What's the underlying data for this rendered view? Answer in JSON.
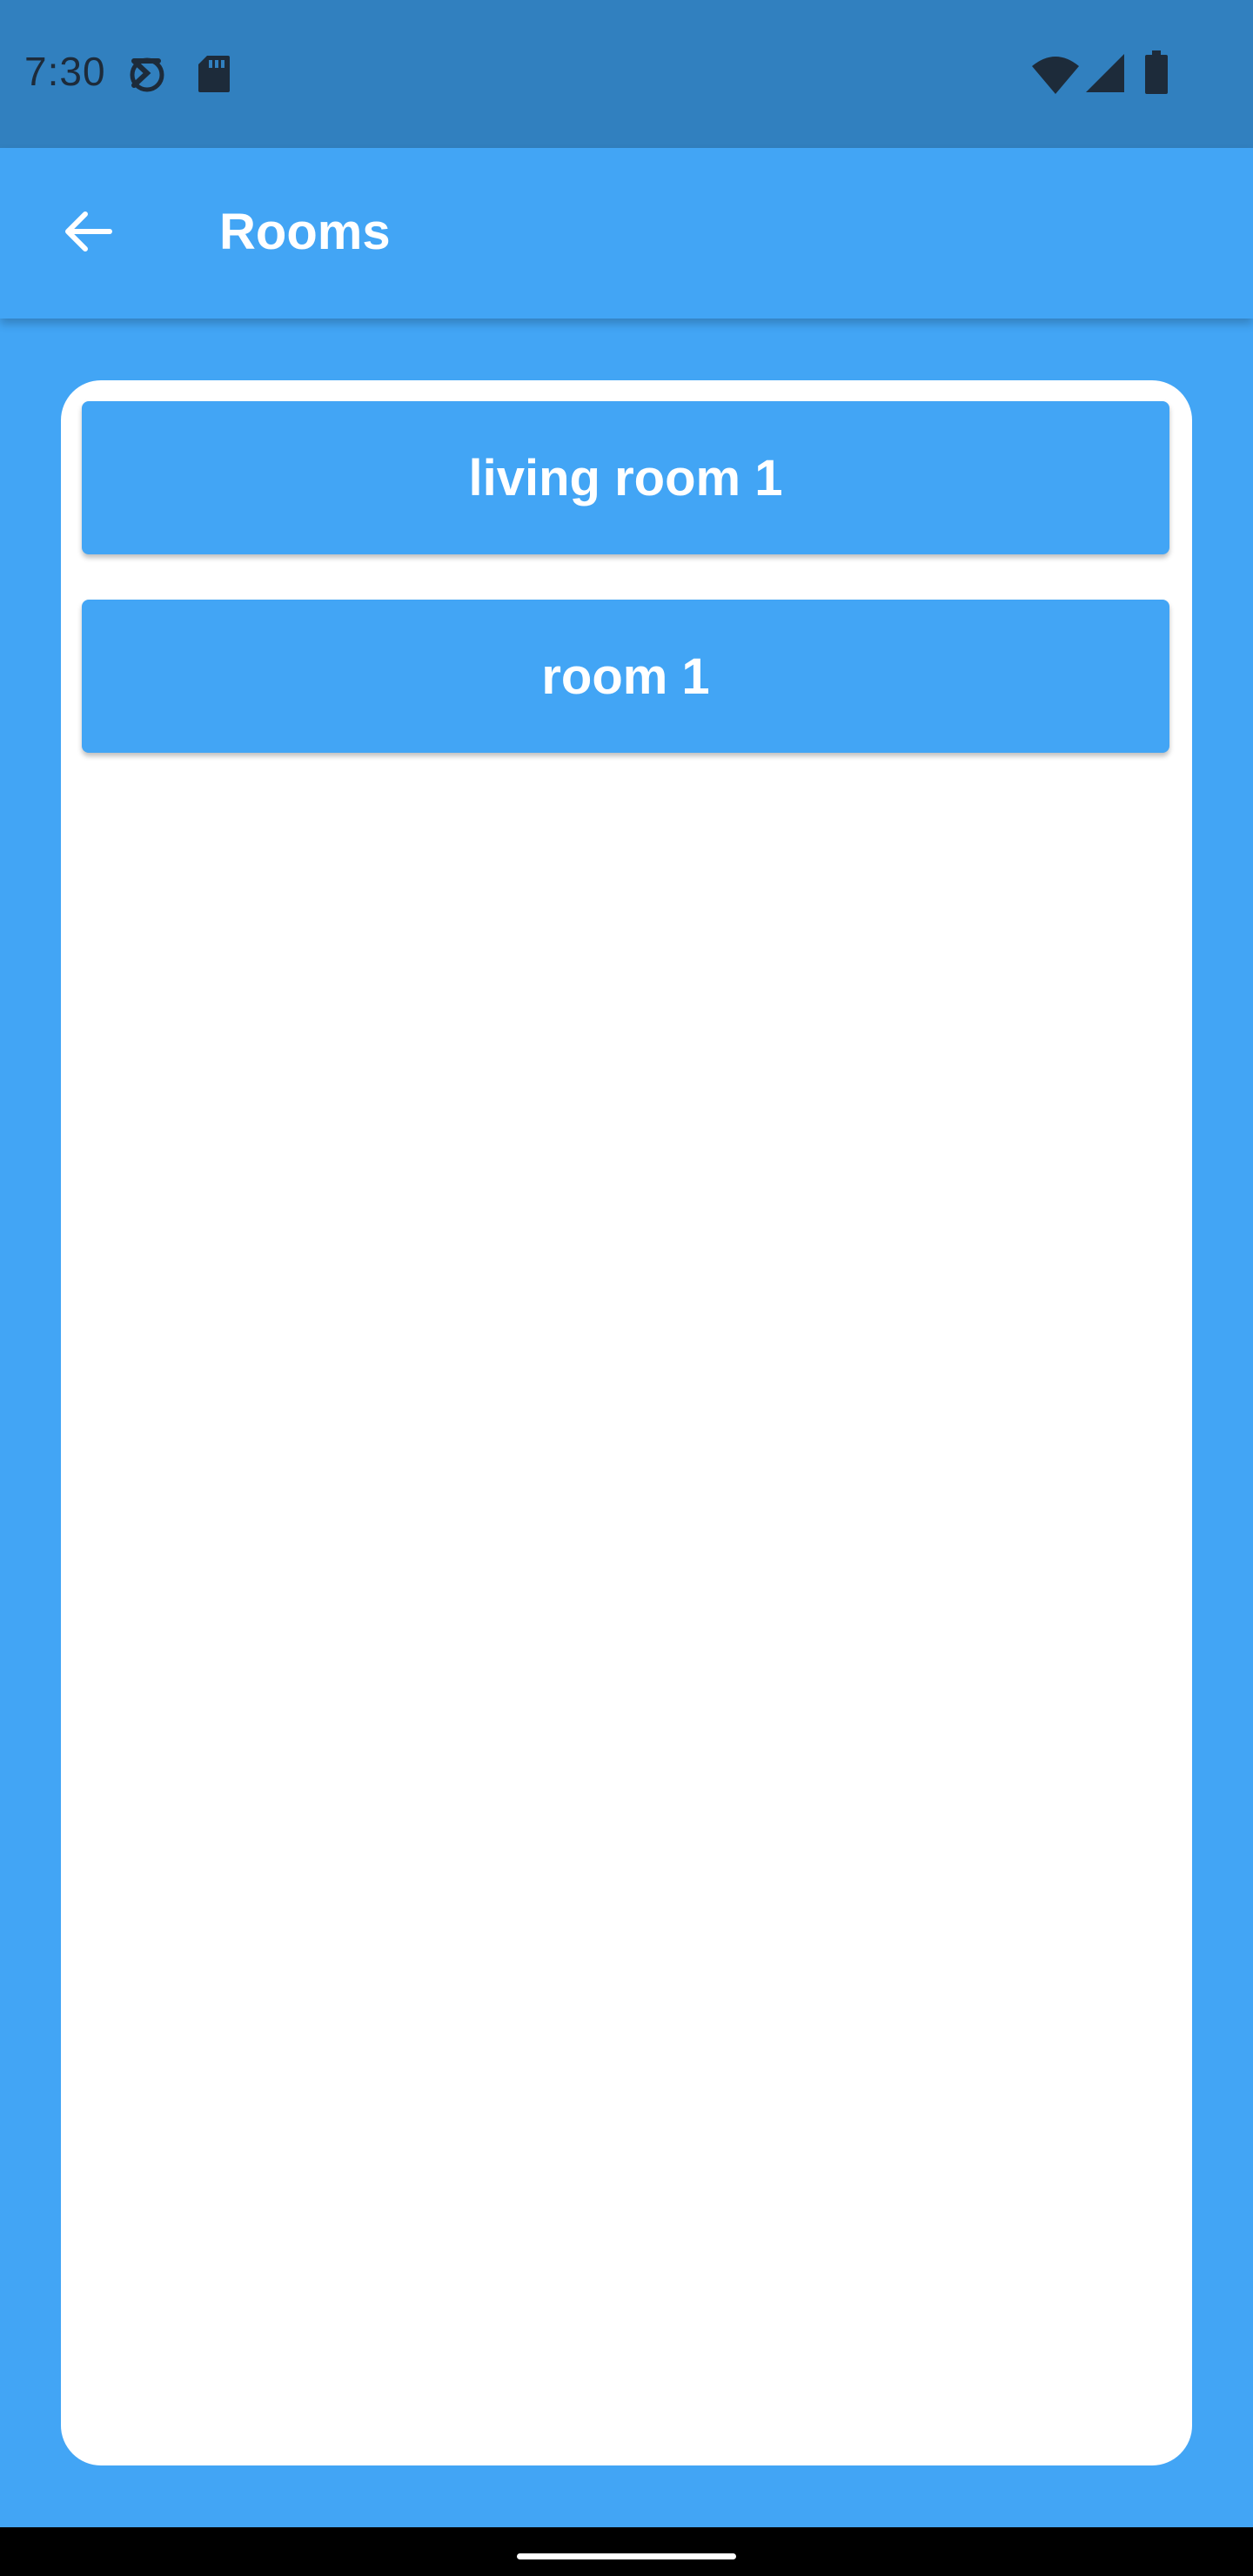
{
  "status_bar": {
    "time": "7:30",
    "icons": [
      "data-saver-icon",
      "sd-card-icon",
      "wifi-icon",
      "cell-signal-icon",
      "battery-icon"
    ]
  },
  "app_bar": {
    "title": "Rooms",
    "back_icon": "arrow-back-icon"
  },
  "rooms": [
    {
      "label": "living room 1"
    },
    {
      "label": "room 1"
    }
  ],
  "colors": {
    "primary": "#42a5f5",
    "status_bar": "#3180bf",
    "card": "#ffffff",
    "text_on_primary": "#ffffff"
  }
}
